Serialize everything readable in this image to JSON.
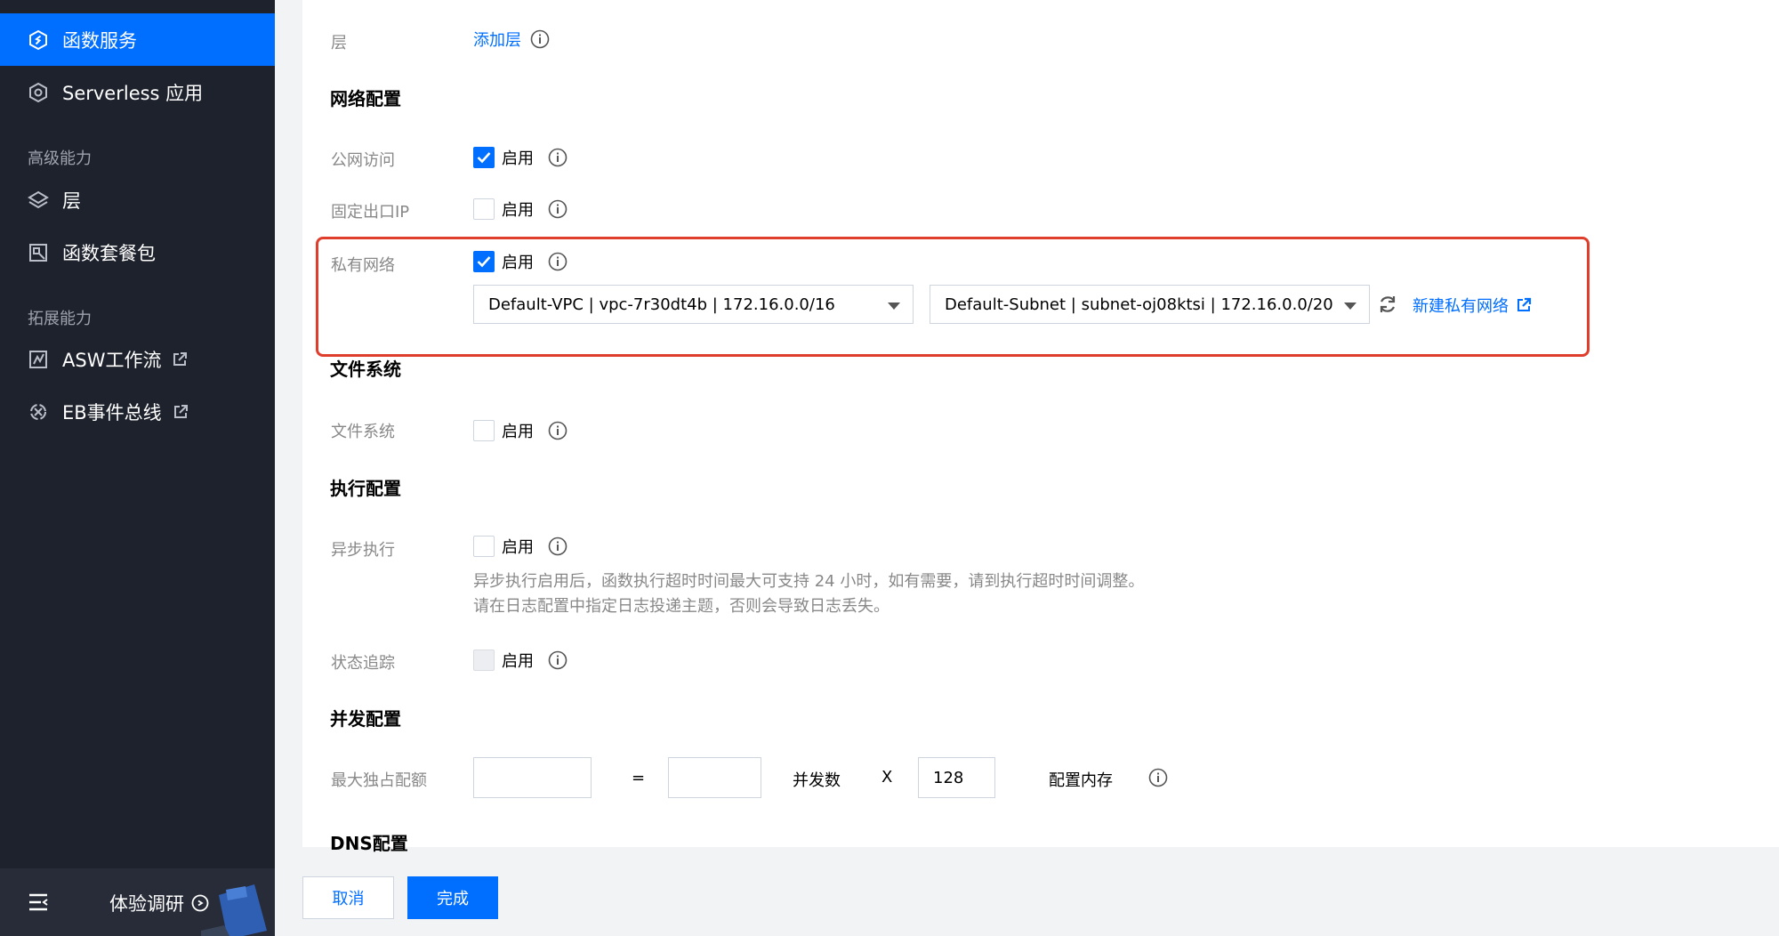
{
  "sidebar": {
    "items": [
      {
        "label": "函数服务",
        "icon": "function-service-icon"
      },
      {
        "label": "Serverless 应用",
        "icon": "serverless-app-icon"
      },
      {
        "label": "层",
        "icon": "layers-icon"
      },
      {
        "label": "函数套餐包",
        "icon": "package-icon"
      },
      {
        "label": "ASW工作流",
        "icon": "workflow-icon"
      },
      {
        "label": "EB事件总线",
        "icon": "event-bus-icon"
      }
    ],
    "groups": [
      "高级能力",
      "拓展能力"
    ],
    "footer": {
      "survey_label": "体验调研"
    }
  },
  "form": {
    "layer": {
      "label": "层",
      "add_link": "添加层"
    },
    "network": {
      "title": "网络配置",
      "public_access": {
        "label": "公网访问",
        "option": "启用",
        "checked": true
      },
      "fixed_ip": {
        "label": "固定出口IP",
        "option": "启用",
        "checked": false
      },
      "vpc": {
        "label": "私有网络",
        "option": "启用",
        "checked": true,
        "vpc_select": "Default-VPC | vpc-7r30dt4b | 172.16.0.0/16",
        "subnet_select": "Default-Subnet | subnet-oj08ktsi | 172.16.0.0/20",
        "new_link": "新建私有网络"
      }
    },
    "filesystem": {
      "title": "文件系统",
      "fs": {
        "label": "文件系统",
        "option": "启用",
        "checked": false
      }
    },
    "execution": {
      "title": "执行配置",
      "async": {
        "label": "异步执行",
        "option": "启用",
        "checked": false,
        "hint1": "异步执行启用后，函数执行超时时间最大可支持 24 小时，如有需要，请到执行超时时间调整。",
        "hint2": "请在日志配置中指定日志投递主题，否则会导致日志丢失。"
      },
      "tracking": {
        "label": "状态追踪",
        "option": "启用",
        "checked": false
      }
    },
    "concurrency": {
      "title": "并发配置",
      "label": "最大独占配额",
      "equals": "=",
      "concurrency_label": "并发数",
      "times": "X",
      "memory_value": "128",
      "memory_label": "配置内存"
    },
    "dns": {
      "title": "DNS配置"
    }
  },
  "actions": {
    "cancel": "取消",
    "done": "完成"
  },
  "colors": {
    "primary": "#006eff",
    "sidebar_bg": "#1e222d",
    "highlight": "#e03e2d"
  }
}
